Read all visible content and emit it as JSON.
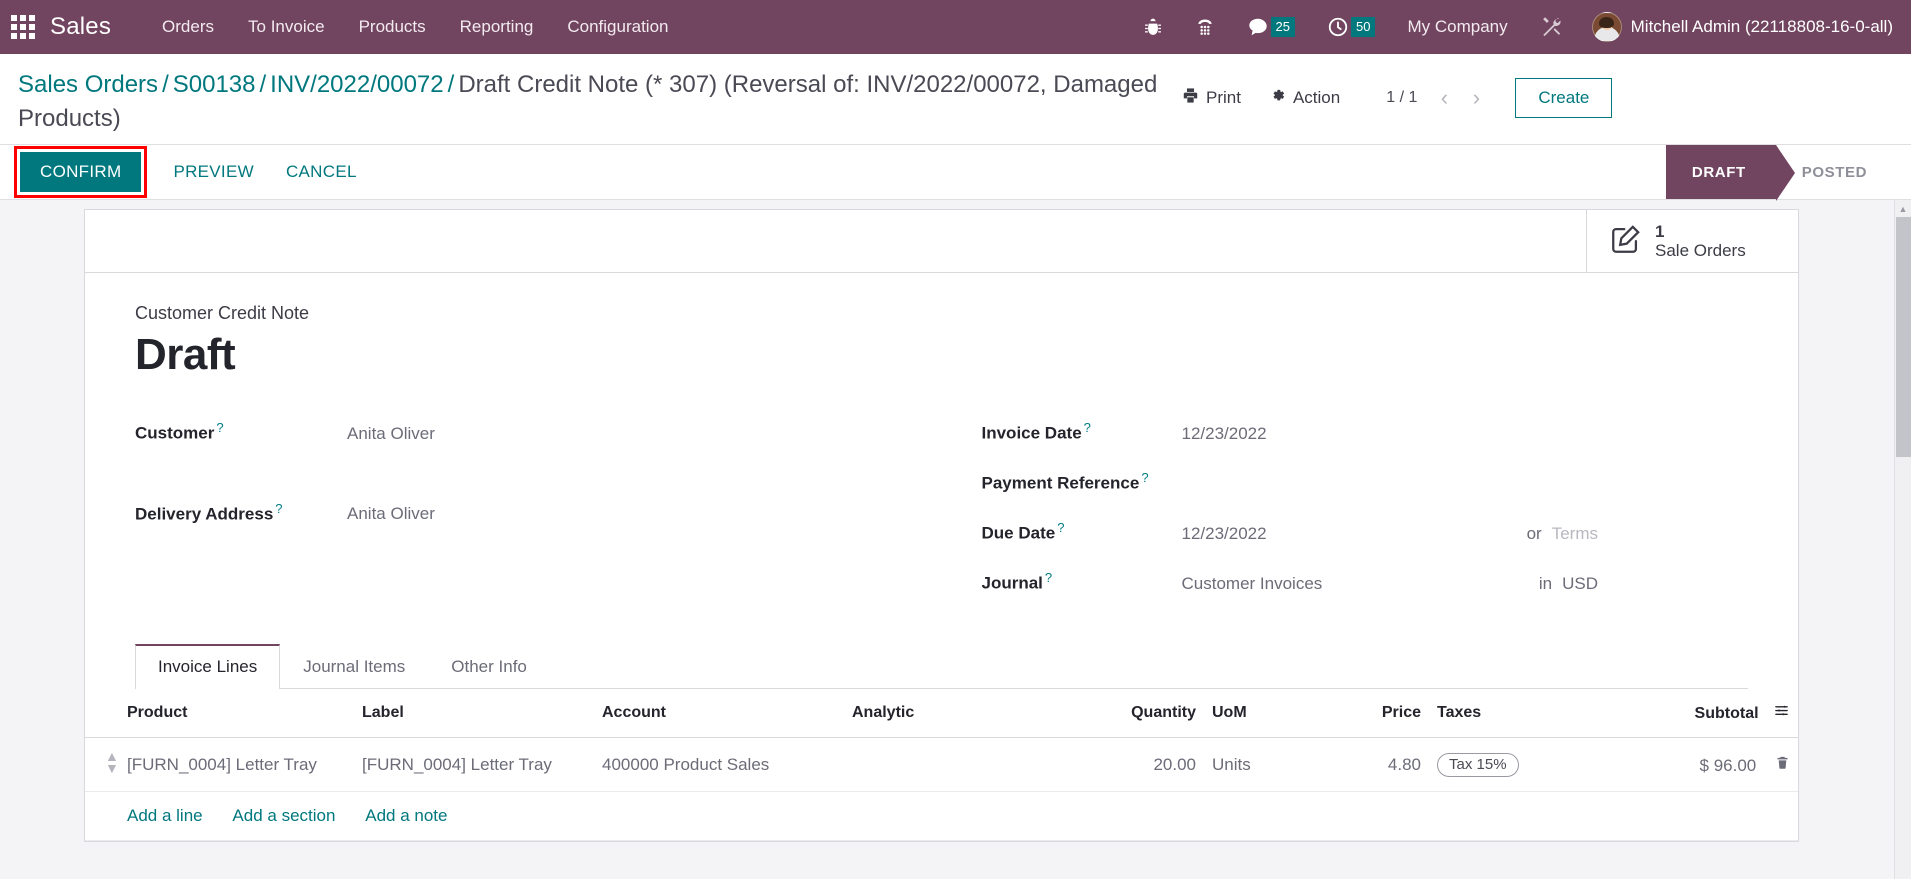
{
  "navbar": {
    "apps_icon": "apps-grid-icon",
    "brand": "Sales",
    "menu": [
      {
        "label": "Orders"
      },
      {
        "label": "To Invoice"
      },
      {
        "label": "Products"
      },
      {
        "label": "Reporting"
      },
      {
        "label": "Configuration"
      }
    ],
    "icons": [
      {
        "name": "bug-icon"
      },
      {
        "name": "dialpad-icon"
      },
      {
        "name": "messages-icon",
        "badge": "25"
      },
      {
        "name": "activities-clock-icon",
        "badge": "50"
      }
    ],
    "company": "My Company",
    "settings_icon": "tools-icon",
    "user_name": "Mitchell Admin (22118808-16-0-all)",
    "background_color": "#71445f",
    "badge_color": "#00787e"
  },
  "breadcrumb": {
    "items": [
      {
        "label": "Sales Orders",
        "link": true
      },
      {
        "label": "S00138",
        "link": true
      },
      {
        "label": "INV/2022/00072",
        "link": true
      },
      {
        "label": "Draft Credit Note (* 307) (Reversal of: INV/2022/00072, Damaged Products)",
        "link": false
      }
    ],
    "separator": "/"
  },
  "control_panel": {
    "print_label": "Print",
    "action_label": "Action",
    "pager_count": "1 / 1",
    "prev_icon": "chevron-left-icon",
    "next_icon": "chevron-right-icon",
    "create_label": "Create"
  },
  "statusbar": {
    "buttons": [
      {
        "label": "CONFIRM",
        "style": "primary",
        "highlighted": true
      },
      {
        "label": "PREVIEW",
        "style": "link"
      },
      {
        "label": "CANCEL",
        "style": "link"
      }
    ],
    "stages": [
      {
        "label": "DRAFT",
        "active": true
      },
      {
        "label": "POSTED",
        "active": false
      }
    ],
    "active_color": "#71445f",
    "primary_color": "#00787e",
    "highlight_color": "#ff0000"
  },
  "stat_button": {
    "icon": "pencil-square-icon",
    "value": "1",
    "label": "Sale Orders"
  },
  "form": {
    "doc_type": "Customer Credit Note",
    "title": "Draft",
    "left_fields": [
      {
        "label": "Customer",
        "help": "?",
        "value": "Anita Oliver"
      },
      {
        "label": "Delivery Address",
        "help": "?",
        "value": "Anita Oliver"
      }
    ],
    "right_fields": [
      {
        "label": "Invoice Date",
        "help": "?",
        "value": "12/23/2022",
        "suffix_label": "",
        "suffix_value": ""
      },
      {
        "label": "Payment Reference",
        "help": "?",
        "value": "",
        "suffix_label": "",
        "suffix_value": ""
      },
      {
        "label": "Due Date",
        "help": "?",
        "value": "12/23/2022",
        "suffix_label": "or",
        "suffix_value": "Terms",
        "suffix_placeholder": true
      },
      {
        "label": "Journal",
        "help": "?",
        "value": "Customer Invoices",
        "suffix_label": "in",
        "suffix_value": "USD",
        "suffix_placeholder": false
      }
    ]
  },
  "notebook": {
    "tabs": [
      {
        "label": "Invoice Lines",
        "active": true
      },
      {
        "label": "Journal Items",
        "active": false
      },
      {
        "label": "Other Info",
        "active": false
      }
    ]
  },
  "lines": {
    "columns": [
      "Product",
      "Label",
      "Account",
      "Analytic",
      "Quantity",
      "UoM",
      "Price",
      "Taxes",
      "Subtotal"
    ],
    "optional_columns_icon": "sliders-icon",
    "rows": [
      {
        "handle_icon": "drag-handle-icon",
        "product": "[FURN_0004] Letter Tray",
        "label": "[FURN_0004] Letter Tray",
        "account": "400000 Product Sales",
        "analytic": "",
        "quantity": "20.00",
        "uom": "Units",
        "price": "4.80",
        "taxes": "Tax 15%",
        "subtotal": "$ 96.00",
        "delete_icon": "trash-icon"
      }
    ],
    "add_links": [
      {
        "label": "Add a line"
      },
      {
        "label": "Add a section"
      },
      {
        "label": "Add a note"
      }
    ]
  },
  "scrollbar": {
    "up_icon": "triangle-up-icon",
    "down_icon": "triangle-down-icon"
  }
}
